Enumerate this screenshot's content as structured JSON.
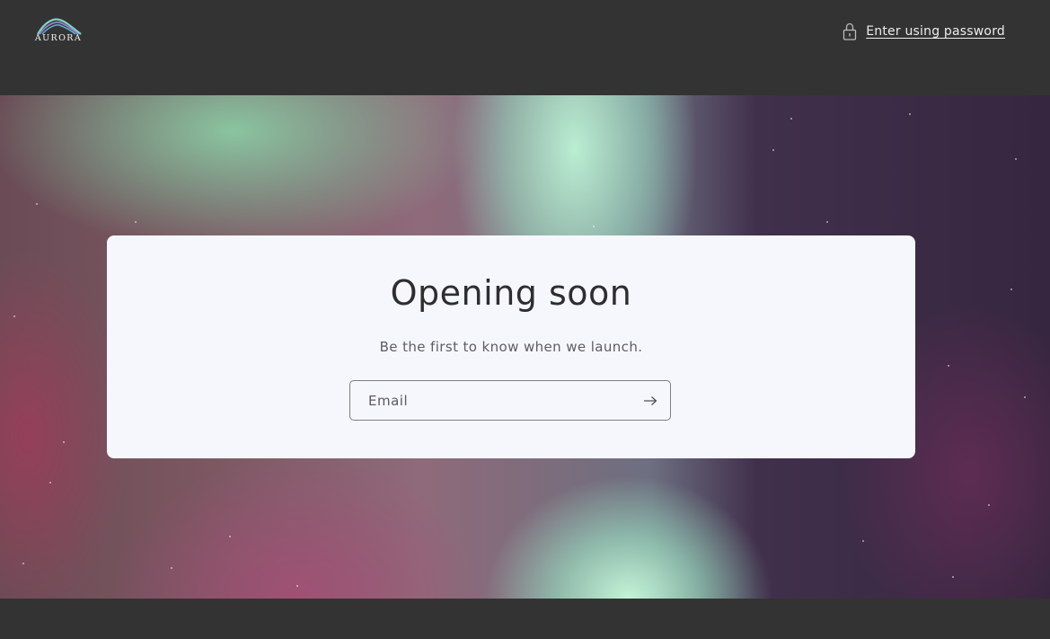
{
  "header": {
    "logo_text": "AURORA",
    "password_link": {
      "label": "Enter using password",
      "icon": "lock-icon"
    }
  },
  "hero": {
    "title": "Opening soon",
    "subtitle": "Be the first to know when we launch.",
    "email": {
      "placeholder": "Email",
      "value": "",
      "submit_icon": "arrow-right-icon"
    }
  },
  "colors": {
    "header_bg": "#333333",
    "card_bg": "#f6f7fc",
    "title_text": "#2e2e31",
    "link_text": "#ececec"
  }
}
